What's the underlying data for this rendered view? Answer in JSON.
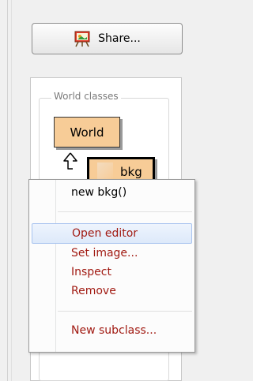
{
  "toolbar": {
    "share_label": "Share..."
  },
  "world_classes": {
    "group_label": "World classes",
    "classes": [
      {
        "name": "World"
      },
      {
        "name": "bkg"
      }
    ]
  },
  "context_menu": {
    "items": [
      {
        "label": "new bkg()",
        "style": "normal"
      },
      {
        "label": "Open editor",
        "style": "red",
        "highlighted": true
      },
      {
        "label": "Set image...",
        "style": "red"
      },
      {
        "label": "Inspect",
        "style": "red"
      },
      {
        "label": "Remove",
        "style": "red"
      },
      {
        "label": "New subclass...",
        "style": "red"
      }
    ]
  },
  "colors": {
    "class_fill": "#f7cc97",
    "menu_action_text": "#a11a12",
    "menu_highlight": "#dde9fa"
  },
  "icons": {
    "share": "easel-picture-icon",
    "inheritance": "hollow-up-arrow-icon"
  }
}
